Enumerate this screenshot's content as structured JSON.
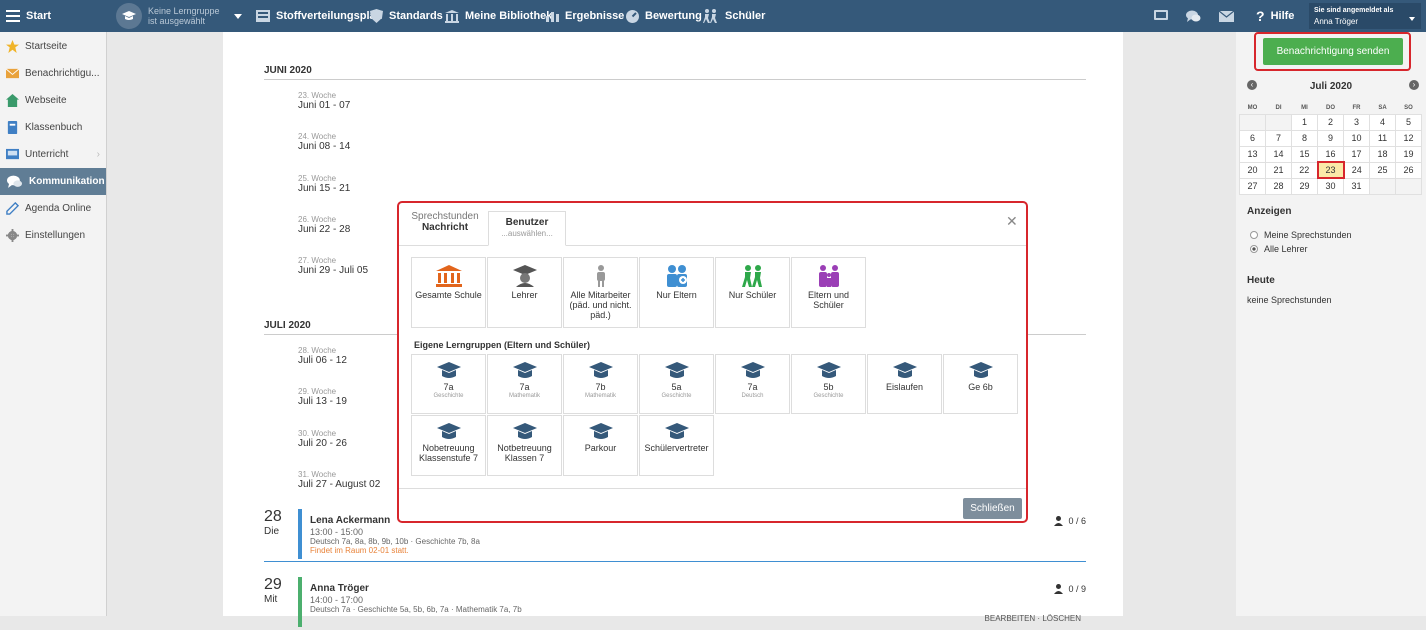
{
  "topbar": {
    "menu_label": "Start",
    "group_line1": "Keine Lerngruppe",
    "group_line2": "ist ausgewählt",
    "nav": [
      "Stoffverteilungsplan",
      "Standards",
      "Meine Bibliothek",
      "Ergebnisse",
      "Bewertung",
      "Schüler"
    ],
    "help": "Hilfe",
    "login_label": "Sie sind angemeldet als",
    "user": "Anna Tröger"
  },
  "sidebar": {
    "items": [
      {
        "label": "Startseite",
        "icon": "star-icon"
      },
      {
        "label": "Benachrichtigu...",
        "icon": "envelope-icon"
      },
      {
        "label": "Webseite",
        "icon": "home-icon"
      },
      {
        "label": "Klassenbuch",
        "icon": "book-icon"
      },
      {
        "label": "Unterricht",
        "icon": "classroom-icon"
      },
      {
        "label": "Kommunikation",
        "icon": "chat-icon"
      },
      {
        "label": "Agenda Online",
        "icon": "pencil-icon"
      },
      {
        "label": "Einstellungen",
        "icon": "gear-icon"
      }
    ]
  },
  "main": {
    "month_june": "JUNI 2020",
    "month_july": "JULI 2020",
    "weeks_june": [
      {
        "week": "23. Woche",
        "range": "Juni 01 - 07"
      },
      {
        "week": "24. Woche",
        "range": "Juni 08 - 14"
      },
      {
        "week": "25. Woche",
        "range": "Juni 15 - 21"
      },
      {
        "week": "26. Woche",
        "range": "Juni 22 - 28"
      },
      {
        "week": "27. Woche",
        "range": "Juni 29 - Juli 05"
      }
    ],
    "weeks_july": [
      {
        "week": "28. Woche",
        "range": "Juli 06 - 12"
      },
      {
        "week": "29. Woche",
        "range": "Juli 13 - 19"
      },
      {
        "week": "30. Woche",
        "range": "Juli 20 - 26"
      },
      {
        "week": "31. Woche",
        "range": "Juli 27 - August 02"
      }
    ],
    "events": [
      {
        "day": "28",
        "dayname": "Die",
        "name": "Lena Ackermann",
        "time": "13:00 - 15:00",
        "classes": "Deutsch 7a, 8a, 8b, 9b, 10b · Geschichte 7b, 8a",
        "room": "Findet im Raum 02-01 statt.",
        "count": "0 / 6",
        "color": "#3f8fd2"
      },
      {
        "day": "29",
        "dayname": "Mit",
        "name": "Anna Tröger",
        "time": "14:00 - 17:00",
        "classes": "Deutsch 7a · Geschichte 5a, 5b, 6b, 7a · Mathematik 7a, 7b",
        "room": "",
        "count": "0 / 9",
        "color": "#4caf6e"
      }
    ],
    "actions": "BEARBEITEN · LÖSCHEN"
  },
  "right": {
    "send_button": "Benachrichtigung senden",
    "calendar_title": "Juli 2020",
    "weekdays": [
      "MO",
      "DI",
      "MI",
      "DO",
      "FR",
      "SA",
      "SO"
    ],
    "weeks": [
      [
        "",
        "",
        "1",
        "2",
        "3",
        "4",
        "5"
      ],
      [
        "6",
        "7",
        "8",
        "9",
        "10",
        "11",
        "12"
      ],
      [
        "13",
        "14",
        "15",
        "16",
        "17",
        "18",
        "19"
      ],
      [
        "20",
        "21",
        "22",
        "23",
        "24",
        "25",
        "26"
      ],
      [
        "27",
        "28",
        "29",
        "30",
        "31",
        "",
        ""
      ]
    ],
    "highlight_day": "23",
    "show_title": "Anzeigen",
    "radio_mine": "Meine Sprechstunden",
    "radio_all": "Alle Lehrer",
    "today_title": "Heute",
    "today_text": "keine Sprechstunden"
  },
  "modal": {
    "tab1_line1": "Sprechstunden",
    "tab1_line2": "Nachricht",
    "tab2_line1": "Benutzer",
    "tab2_line2": "...auswählen...",
    "tiles": [
      {
        "label": "Gesamte Schule",
        "icon": "school-icon",
        "color": "#e2651c"
      },
      {
        "label": "Lehrer",
        "icon": "teacher-icon",
        "color": "#555555"
      },
      {
        "label": "Alle Mitarbeiter (päd. und nicht. päd.)",
        "icon": "person-icon",
        "color": "#999999"
      },
      {
        "label": "Nur Eltern",
        "icon": "parents-icon",
        "color": "#3f8fd2"
      },
      {
        "label": "Nur Schüler",
        "icon": "students-icon",
        "color": "#2ea84a"
      },
      {
        "label": "Eltern und Schüler",
        "icon": "family-icon",
        "color": "#9b3fb6"
      }
    ],
    "groups_title": "Eigene Lerngruppen (Eltern und Schüler)",
    "groups": [
      {
        "name": "7a",
        "sub": "Geschichte"
      },
      {
        "name": "7a",
        "sub": "Mathematik"
      },
      {
        "name": "7b",
        "sub": "Mathematik"
      },
      {
        "name": "5a",
        "sub": "Geschichte"
      },
      {
        "name": "7a",
        "sub": "Deutsch"
      },
      {
        "name": "5b",
        "sub": "Geschichte"
      },
      {
        "name": "Eislaufen",
        "sub": ""
      },
      {
        "name": "Ge 6b",
        "sub": ""
      },
      {
        "name": "Nobetreuung Klassenstufe 7",
        "sub": ""
      },
      {
        "name": "Notbetreuung Klassen 7",
        "sub": ""
      },
      {
        "name": "Parkour",
        "sub": ""
      },
      {
        "name": "Schülervertreter",
        "sub": ""
      }
    ],
    "close_button": "Schließen"
  }
}
